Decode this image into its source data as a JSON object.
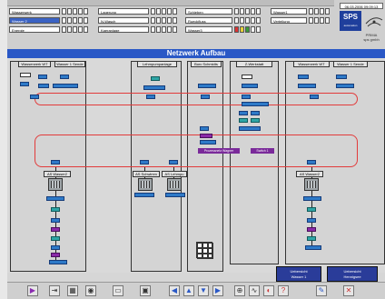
{
  "header": {
    "clock": "06.03.2006 09:09:13",
    "groups": [
      {
        "rows": [
          {
            "label": "Wasserwerk",
            "selected": false
          },
          {
            "label": "Wasser 2",
            "selected": true
          },
          {
            "label": "Energie",
            "selected": false
          }
        ]
      },
      {
        "rows": [
          {
            "label": "Lagerung",
            "selected": false
          },
          {
            "label": "N-Wasch",
            "selected": false
          },
          {
            "label": "Kaeranlage",
            "selected": false
          }
        ]
      },
      {
        "rows": [
          {
            "label": "Schieben",
            "selected": false
          },
          {
            "label": "Rueckfluss",
            "selected": false
          },
          {
            "label": "Wasser3",
            "selected": false
          }
        ]
      },
      {
        "rows": [
          {
            "label": "Wasser1",
            "selected": false
          },
          {
            "label": "Verteilung",
            "selected": false
          }
        ]
      }
    ],
    "sps_brand": "SPS",
    "sps_sub": "automation",
    "logo_line1": "PRIMA",
    "logo_line2": "sps gmbh",
    "accent": "#2a58c6"
  },
  "page_title": "Netzwerk Aufbau",
  "sections": [
    {
      "title": "Wasserwerk WT"
    },
    {
      "title": "Wasser 1 Sende"
    },
    {
      "title": "Lehmpumpanlage"
    },
    {
      "title": "Burc Schmidts"
    },
    {
      "title": "Z-Werkstatt"
    },
    {
      "title": "Wasserwerk WT"
    },
    {
      "title": "Wasser 1 Sende"
    }
  ],
  "ring_labels": {
    "upper_left": "Prozessnetz Wagner",
    "upper_right": "Switch 1",
    "lower_left": "AS Wasser2",
    "lower_mid": "AS Schwimm",
    "lower_mid2": "AS Lehmpu",
    "lower_right": "AS Wasser2"
  },
  "buttons": {
    "uebersicht_1_line1": "Uebersicht",
    "uebersicht_1_line2": "Wasser 1",
    "uebersicht_2_line1": "Uebersicht",
    "uebersicht_2_line2": "Hennigsee"
  },
  "toolbar": {
    "icons": [
      "play-icon",
      "login-icon",
      "print-icon",
      "alarm-icon",
      "screen-icon",
      "config-icon",
      "back-icon",
      "up-icon",
      "down-icon",
      "forward-icon",
      "zoom-icon",
      "trend-icon",
      "help-icon",
      "chart-icon",
      "exit-icon"
    ]
  }
}
